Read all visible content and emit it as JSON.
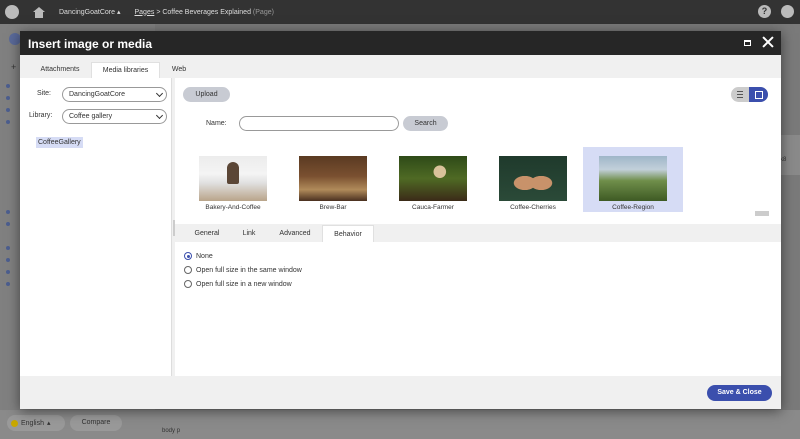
{
  "topbar": {
    "site_name": "DancingGoatCore",
    "breadcrumb_pages": "Pages",
    "breadcrumb_separator": ">",
    "breadcrumb_page": "Coffee Beverages Explained",
    "breadcrumb_page_type": "(Page)",
    "help_label": "?"
  },
  "background": {
    "plus_label": "+",
    "right_panel_text": "k8",
    "language_label": "English",
    "compare_label": "Compare",
    "path_body": "body",
    "path_p": "p"
  },
  "modal": {
    "title": "Insert image or media",
    "tabs": [
      {
        "label": "Attachments",
        "active": false
      },
      {
        "label": "Media libraries",
        "active": true
      },
      {
        "label": "Web",
        "active": false
      }
    ],
    "left": {
      "site_label": "Site:",
      "site_value": "DancingGoatCore",
      "library_label": "Library:",
      "library_value": "Coffee gallery",
      "tree_item": "CoffeeGallery"
    },
    "toolbar": {
      "upload_label": "Upload",
      "name_label": "Name:",
      "name_value": "",
      "search_label": "Search",
      "view_mode": "thumbnails"
    },
    "media_items": [
      {
        "label": "Bakery-And-Coffee",
        "selected": false
      },
      {
        "label": "Brew-Bar",
        "selected": false
      },
      {
        "label": "Cauca-Farmer",
        "selected": false
      },
      {
        "label": "Coffee-Cherries",
        "selected": false
      },
      {
        "label": "Coffee-Region",
        "selected": true
      }
    ],
    "sub_tabs": [
      {
        "label": "General",
        "active": false
      },
      {
        "label": "Link",
        "active": false
      },
      {
        "label": "Advanced",
        "active": false
      },
      {
        "label": "Behavior",
        "active": true
      }
    ],
    "behavior": {
      "selected": "None",
      "options": [
        "None",
        "Open full size in the same window",
        "Open full size in a new window"
      ]
    },
    "save_label": "Save & Close"
  },
  "colors": {
    "accent": "#3b4fad",
    "selection": "#d6dcf5",
    "header": "#262626"
  }
}
